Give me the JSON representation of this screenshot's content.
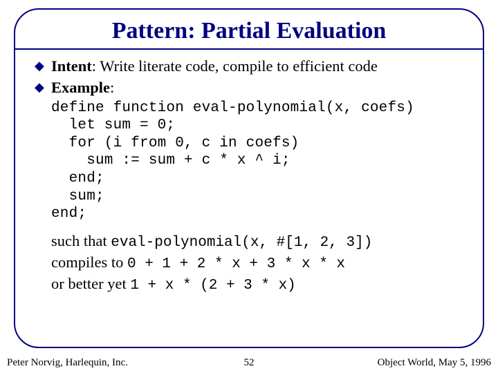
{
  "title": "Pattern: Partial Evaluation",
  "bullets": {
    "intent": {
      "label": "Intent",
      "text": ": Write literate code, compile to efficient code"
    },
    "example": {
      "label": "Example",
      "text": ":"
    }
  },
  "code": "define function eval-polynomial(x, coefs)\n  let sum = 0;\n  for (i from 0, c in coefs)\n    sum := sum + c * x ^ i;\n  end;\n  sum;\nend;",
  "tail": {
    "l1_pre": "such that ",
    "l1_code": "eval-polynomial(x, #[1, 2, 3])",
    "l2_pre": "compiles to ",
    "l2_code": "0 + 1 + 2 * x + 3 * x * x",
    "l3_pre": "or better yet ",
    "l3_code": "1 + x * (2 + 3 * x)"
  },
  "footer": {
    "left": "Peter Norvig, Harlequin, Inc.",
    "center": "52",
    "right": "Object World, May 5, 1996"
  }
}
